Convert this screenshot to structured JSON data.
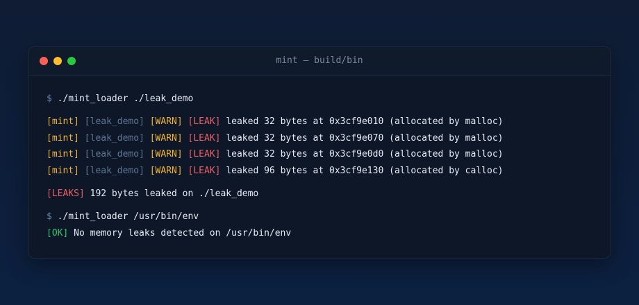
{
  "window": {
    "title": "mint — build/bin",
    "controls": {
      "close_color": "#ff5f57",
      "minimize_color": "#febc2e",
      "maximize_color": "#28c840"
    }
  },
  "terminal": {
    "prompt": "$",
    "command1": "./mint_loader ./leak_demo",
    "leak_lines": [
      {
        "tag1": "[mint]",
        "tag2": "[leak_demo]",
        "tag3": "[WARN]",
        "tag4": "[LEAK]",
        "message": "leaked 32 bytes at 0x3cf9e010 (allocated by malloc)"
      },
      {
        "tag1": "[mint]",
        "tag2": "[leak_demo]",
        "tag3": "[WARN]",
        "tag4": "[LEAK]",
        "message": "leaked 32 bytes at 0x3cf9e070 (allocated by malloc)"
      },
      {
        "tag1": "[mint]",
        "tag2": "[leak_demo]",
        "tag3": "[WARN]",
        "tag4": "[LEAK]",
        "message": "leaked 32 bytes at 0x3cf9e0d0 (allocated by malloc)"
      },
      {
        "tag1": "[mint]",
        "tag2": "[leak_demo]",
        "tag3": "[WARN]",
        "tag4": "[LEAK]",
        "message": "leaked 96 bytes at 0x3cf9e130 (allocated by calloc)"
      }
    ],
    "summary_tag": "[LEAKS]",
    "summary_msg": "192 bytes leaked on ./leak_demo",
    "command2": "./mint_loader /usr/bin/env",
    "ok_tag": "[OK]",
    "ok_msg": "No memory leaks detected on /usr/bin/env"
  },
  "colors": {
    "mint_tag": "#f0b43c",
    "program_tag": "#5f7594",
    "warn_tag": "#f0b43c",
    "leak_tag": "#ec5f66",
    "ok_tag": "#36c76a",
    "text": "#e6ebf5"
  }
}
